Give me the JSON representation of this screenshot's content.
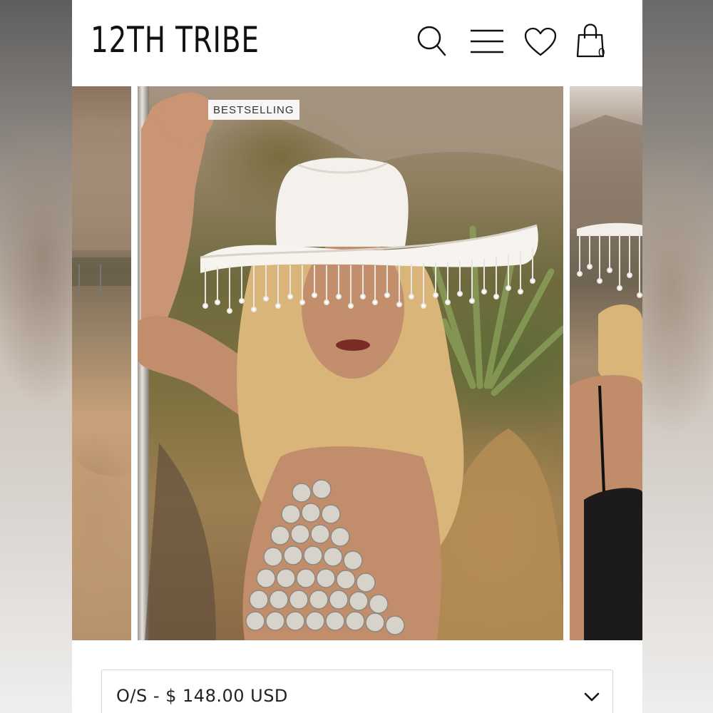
{
  "brand": {
    "logo_text": "12TH TRIBE"
  },
  "header": {
    "icons": [
      "search-icon",
      "menu-icon",
      "heart-icon",
      "bag-icon"
    ],
    "cart_count": "0"
  },
  "gallery": {
    "badge": "BESTSELLING",
    "slides": [
      "previous product photo",
      "product photo: model in white fringe cowboy hat",
      "next product photo"
    ]
  },
  "variant_select": {
    "selected_value": "O/S - $ 148.00 USD",
    "icon": "chevron-down-icon"
  },
  "colors": {
    "text": "#111111",
    "border": "#d4d4d4",
    "background": "#ffffff"
  }
}
